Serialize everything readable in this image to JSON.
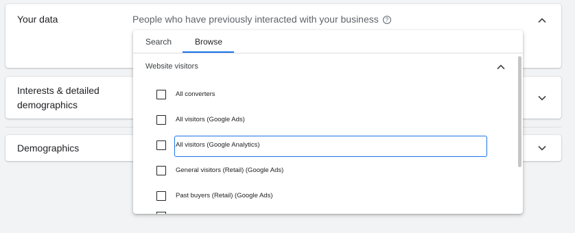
{
  "cards": [
    {
      "title": "Your data",
      "desc": "People who have previously interacted with your business",
      "help_icon": "?",
      "chevron": "up"
    },
    {
      "title_line1": "Interests & detailed",
      "title_line2": "demographics",
      "chevron": "down"
    },
    {
      "title": "Demographics",
      "chevron": "down"
    }
  ],
  "dropdown": {
    "tabs": [
      {
        "label": "Search",
        "active": false
      },
      {
        "label": "Browse",
        "active": true
      }
    ],
    "section": {
      "label": "Website visitors",
      "expanded": true
    },
    "options": [
      {
        "label": "All converters",
        "checked": false
      },
      {
        "label": "All visitors (Google Ads)",
        "checked": false
      },
      {
        "label": "All visitors (Google Analytics)",
        "checked": false,
        "focused": true
      },
      {
        "label": "General visitors (Retail) (Google Ads)",
        "checked": false
      },
      {
        "label": "Past buyers (Retail) (Google Ads)",
        "checked": false
      }
    ]
  },
  "colors": {
    "accent": "#1a73e8",
    "text": "#202124",
    "muted": "#5f6368",
    "background": "#f1f3f4"
  },
  "icons": {
    "expand": "chevron-down-icon",
    "collapse": "chevron-up-icon",
    "help": "help-circle-icon"
  }
}
